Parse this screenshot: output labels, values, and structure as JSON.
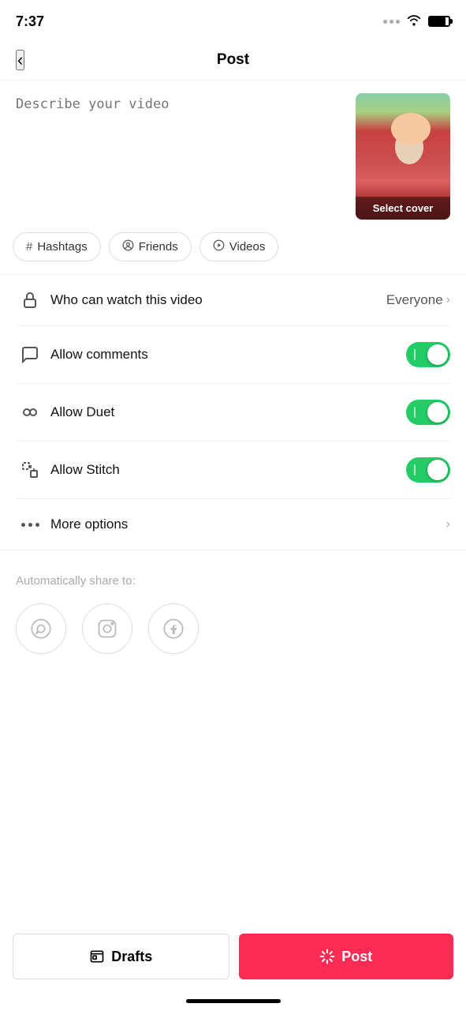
{
  "statusBar": {
    "time": "7:37"
  },
  "header": {
    "title": "Post",
    "backLabel": "‹"
  },
  "description": {
    "placeholder": "Describe your video"
  },
  "cover": {
    "label": "Select cover"
  },
  "tags": [
    {
      "id": "hashtags",
      "icon": "#",
      "label": "Hashtags"
    },
    {
      "id": "friends",
      "icon": "@",
      "label": "Friends"
    },
    {
      "id": "videos",
      "icon": "▷",
      "label": "Videos"
    }
  ],
  "settings": {
    "whoCanWatch": {
      "label": "Who can watch this video",
      "value": "Everyone"
    },
    "allowComments": {
      "label": "Allow comments",
      "enabled": true
    },
    "allowDuet": {
      "label": "Allow Duet",
      "enabled": true
    },
    "allowStitch": {
      "label": "Allow Stitch",
      "enabled": true
    },
    "moreOptions": {
      "label": "More options"
    }
  },
  "shareSection": {
    "title": "Automatically share to:"
  },
  "bottomButtons": {
    "drafts": "Drafts",
    "post": "Post"
  },
  "colors": {
    "toggleOn": "#22cc66",
    "postBtn": "#fe2c55"
  }
}
